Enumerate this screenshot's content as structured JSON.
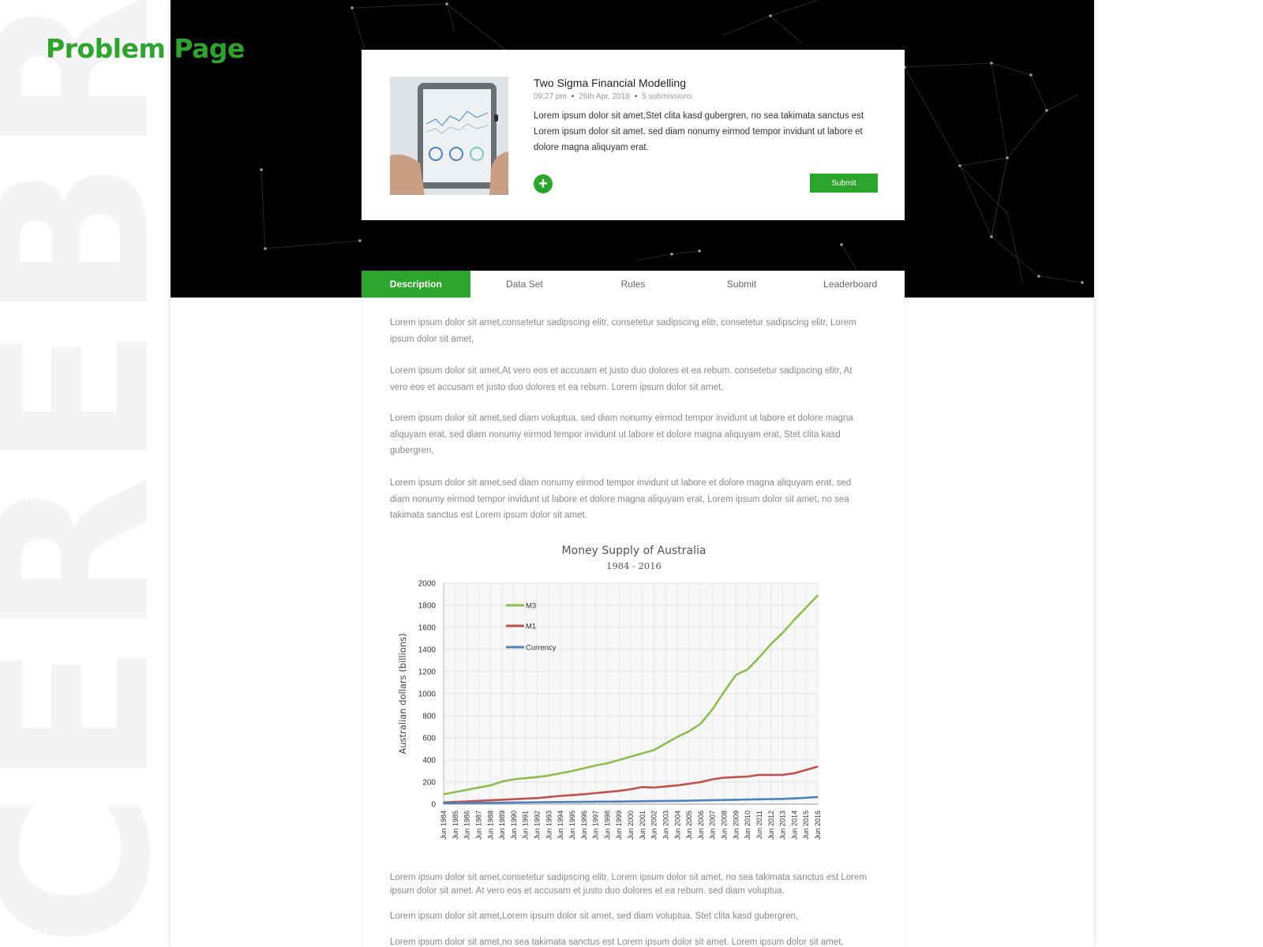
{
  "brand_watermark": "CEREBRO",
  "page_label": "Problem Page",
  "problem": {
    "title": "Two Sigma Financial Modelling",
    "time": "09:27 pm",
    "date": "26th Apr, 2018",
    "submissions": "5 submissions",
    "description": "Lorem ipsum dolor sit amet,Stet clita kasd gubergren,  no sea takimata sanctus est Lorem ipsum dolor sit amet.  sed diam nonumy eirmod tempor invidunt ut labore et dolore magna aliquyam erat.",
    "add_icon": "plus-circle-icon",
    "submit_label": "Submit"
  },
  "tabs": [
    {
      "label": "Description",
      "active": true
    },
    {
      "label": "Data Set",
      "active": false
    },
    {
      "label": "Rules",
      "active": false
    },
    {
      "label": "Submit",
      "active": false
    },
    {
      "label": "Leaderboard",
      "active": false
    }
  ],
  "paragraphs_top": [
    "Lorem ipsum dolor sit amet,consetetur sadipscing elitr,  consetetur sadipscing elitr,  consetetur sadipscing elitr,  Lorem ipsum dolor sit amet,",
    "Lorem ipsum dolor sit amet,At vero eos et accusam et justo duo dolores et ea rebum.  consetetur sadipscing elitr,  At vero eos et accusam et justo duo dolores et ea rebum.  Lorem ipsum dolor sit amet,",
    "Lorem ipsum dolor sit amet,sed diam voluptua.  sed diam nonumy eirmod tempor invidunt ut labore et dolore magna aliquyam erat,  sed diam nonumy eirmod tempor invidunt ut labore et dolore magna aliquyam erat,  Stet clita kasd gubergren,",
    "Lorem ipsum dolor sit amet,sed diam nonumy eirmod tempor invidunt ut labore et dolore magna aliquyam erat,  sed diam nonumy eirmod tempor invidunt ut labore et dolore magna aliquyam erat,  Lorem ipsum dolor sit amet,  no sea takimata sanctus est Lorem ipsum dolor sit amet."
  ],
  "paragraphs_bottom": [
    "Lorem ipsum dolor sit amet,consetetur sadipscing elitr,  Lorem ipsum dolor sit amet,  no sea takimata sanctus est Lorem ipsum dolor sit amet.  At vero eos et accusam et justo duo dolores et ea rebum.  sed diam voluptua.",
    "Lorem ipsum dolor sit amet,Lorem ipsum dolor sit amet,  sed diam voluptua.  Stet clita kasd gubergren,",
    "Lorem ipsum dolor sit amet,no sea takimata sanctus est Lorem ipsum dolor sit amet.  Lorem ipsum dolor sit amet,"
  ],
  "colors": {
    "accent": "#2ca52c",
    "hero_bg": "#000000",
    "m3": "#8fbc4f",
    "m1": "#c0504d",
    "currency": "#4f81bd"
  },
  "chart_data": {
    "type": "line",
    "title": "Money Supply of Australia",
    "subtitle": "1984 - 2016",
    "xlabel": "",
    "ylabel": "Australian dollars (billions)",
    "ylim": [
      0,
      2000
    ],
    "yticks": [
      0,
      200,
      400,
      600,
      800,
      1000,
      1200,
      1400,
      1600,
      1800,
      2000
    ],
    "grid": "horizontal and vertical",
    "legend_placement": "top-left",
    "categories": [
      "Jun 1984",
      "Jun 1985",
      "Jun 1986",
      "Jun 1987",
      "Jun 1988",
      "Jun 1989",
      "Jun 1990",
      "Jun 1991",
      "Jun 1992",
      "Jun 1993",
      "Jun 1994",
      "Jun 1995",
      "Jun 1996",
      "Jun 1997",
      "Jun 1998",
      "Jun 1999",
      "Jun 2000",
      "Jun 2001",
      "Jun 2002",
      "Jun 2003",
      "Jun 2004",
      "Jun 2005",
      "Jun 2006",
      "Jun 2007",
      "Jun 2008",
      "Jun 2009",
      "Jun 2010",
      "Jun 2011",
      "Jun 2012",
      "Jun 2013",
      "Jun 2014",
      "Jun 2015",
      "Jun 2016"
    ],
    "series": [
      {
        "name": "M3",
        "color": "#8fbc4f",
        "values": [
          90,
          110,
          130,
          150,
          170,
          205,
          225,
          235,
          245,
          260,
          280,
          300,
          325,
          350,
          370,
          400,
          430,
          460,
          490,
          550,
          610,
          660,
          730,
          860,
          1020,
          1170,
          1220,
          1330,
          1450,
          1550,
          1670,
          1780,
          1890
        ]
      },
      {
        "name": "M1",
        "color": "#c0504d",
        "values": [
          15,
          20,
          25,
          30,
          35,
          40,
          45,
          50,
          55,
          65,
          75,
          82,
          90,
          100,
          110,
          120,
          135,
          155,
          150,
          160,
          170,
          185,
          200,
          225,
          240,
          245,
          250,
          265,
          265,
          265,
          280,
          310,
          340
        ]
      },
      {
        "name": "Currency",
        "color": "#4f81bd",
        "values": [
          8,
          10,
          11,
          12,
          13,
          14,
          15,
          16,
          17,
          18,
          19,
          20,
          21,
          22,
          23,
          24,
          25,
          26,
          28,
          29,
          30,
          32,
          34,
          36,
          38,
          40,
          42,
          44,
          46,
          48,
          52,
          58,
          65
        ]
      }
    ]
  }
}
